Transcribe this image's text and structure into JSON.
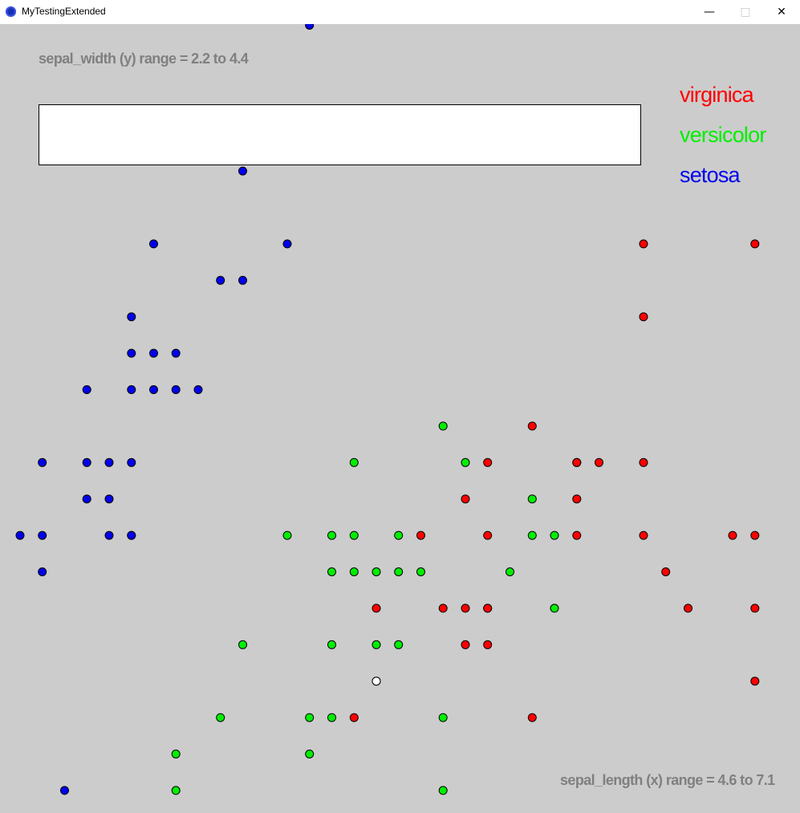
{
  "window": {
    "title": "MyTestingExtended",
    "minimize_icon": "minimize-icon",
    "maximize_icon": "maximize-icon",
    "close_icon": "close-icon"
  },
  "colors": {
    "virginica": "#ff0000",
    "versicolor": "#00ee00",
    "setosa": "#0000ee",
    "selected": "#ffffff",
    "background": "#cccccc",
    "axis_text": "#808080"
  },
  "chart_data": {
    "type": "scatter",
    "y_range_label": "sepal_width (y) range = 2.2 to 4.4",
    "x_range_label": "sepal_length (x) range = 4.6 to 7.1",
    "legend": [
      "virginica",
      "versicolor",
      "setosa"
    ],
    "xlim": [
      4.6,
      7.1
    ],
    "ylim": [
      2.2,
      4.4
    ],
    "series": [
      {
        "name": "setosa",
        "points": [
          [
            5.7,
            4.4
          ],
          [
            5.4,
            4.0
          ],
          [
            5.0,
            3.8
          ],
          [
            5.6,
            3.8
          ],
          [
            5.3,
            3.7
          ],
          [
            5.4,
            3.7
          ],
          [
            4.9,
            3.6
          ],
          [
            4.9,
            3.5
          ],
          [
            5.0,
            3.5
          ],
          [
            5.1,
            3.5
          ],
          [
            4.7,
            3.4
          ],
          [
            4.9,
            3.4
          ],
          [
            5.0,
            3.4
          ],
          [
            5.1,
            3.4
          ],
          [
            5.2,
            3.4
          ],
          [
            4.5,
            3.2
          ],
          [
            4.7,
            3.2
          ],
          [
            4.8,
            3.2
          ],
          [
            4.9,
            3.2
          ],
          [
            4.7,
            3.1
          ],
          [
            4.8,
            3.1
          ],
          [
            4.4,
            3.0
          ],
          [
            4.5,
            3.0
          ],
          [
            4.8,
            3.0
          ],
          [
            4.9,
            3.0
          ],
          [
            4.9,
            3.0
          ],
          [
            4.5,
            2.9
          ],
          [
            4.6,
            2.3
          ]
        ]
      },
      {
        "name": "versicolor",
        "points": [
          [
            6.3,
            3.3
          ],
          [
            5.9,
            3.2
          ],
          [
            6.4,
            3.2
          ],
          [
            6.9,
            3.2
          ],
          [
            6.7,
            3.1
          ],
          [
            5.6,
            3.0
          ],
          [
            5.8,
            3.0
          ],
          [
            5.9,
            3.0
          ],
          [
            6.1,
            3.0
          ],
          [
            6.8,
            3.0
          ],
          [
            6.7,
            3.0
          ],
          [
            5.8,
            2.9
          ],
          [
            5.9,
            2.9
          ],
          [
            6.0,
            2.9
          ],
          [
            6.1,
            2.9
          ],
          [
            6.2,
            2.9
          ],
          [
            6.6,
            2.9
          ],
          [
            6.5,
            2.8
          ],
          [
            6.8,
            2.8
          ],
          [
            5.4,
            2.7
          ],
          [
            5.8,
            2.7
          ],
          [
            6.0,
            2.7
          ],
          [
            6.1,
            2.7
          ],
          [
            6.0,
            2.6
          ],
          [
            5.3,
            2.5
          ],
          [
            5.7,
            2.5
          ],
          [
            5.8,
            2.5
          ],
          [
            6.3,
            2.5
          ],
          [
            5.1,
            2.4
          ],
          [
            5.7,
            2.4
          ],
          [
            5.1,
            2.3
          ],
          [
            6.3,
            2.3
          ],
          [
            6.2,
            2.2
          ]
        ]
      },
      {
        "name": "virginica",
        "points": [
          [
            7.2,
            3.8
          ],
          [
            7.7,
            3.8
          ],
          [
            7.2,
            3.6
          ],
          [
            6.7,
            3.3
          ],
          [
            6.5,
            3.2
          ],
          [
            6.9,
            3.2
          ],
          [
            7.0,
            3.2
          ],
          [
            7.2,
            3.2
          ],
          [
            6.4,
            3.1
          ],
          [
            6.9,
            3.1
          ],
          [
            6.2,
            3.0
          ],
          [
            6.5,
            3.0
          ],
          [
            6.9,
            3.0
          ],
          [
            7.2,
            3.0
          ],
          [
            7.6,
            3.0
          ],
          [
            7.7,
            3.0
          ],
          [
            7.3,
            2.9
          ],
          [
            6.0,
            2.8
          ],
          [
            6.3,
            2.8
          ],
          [
            6.4,
            2.8
          ],
          [
            6.5,
            2.8
          ],
          [
            7.4,
            2.8
          ],
          [
            7.7,
            2.8
          ],
          [
            6.4,
            2.7
          ],
          [
            6.5,
            2.7
          ],
          [
            7.7,
            2.6
          ],
          [
            5.9,
            2.5
          ],
          [
            6.7,
            2.5
          ],
          [
            6.1,
            2.2
          ]
        ]
      },
      {
        "name": "selected",
        "points": [
          [
            6.0,
            2.6
          ]
        ]
      }
    ]
  }
}
